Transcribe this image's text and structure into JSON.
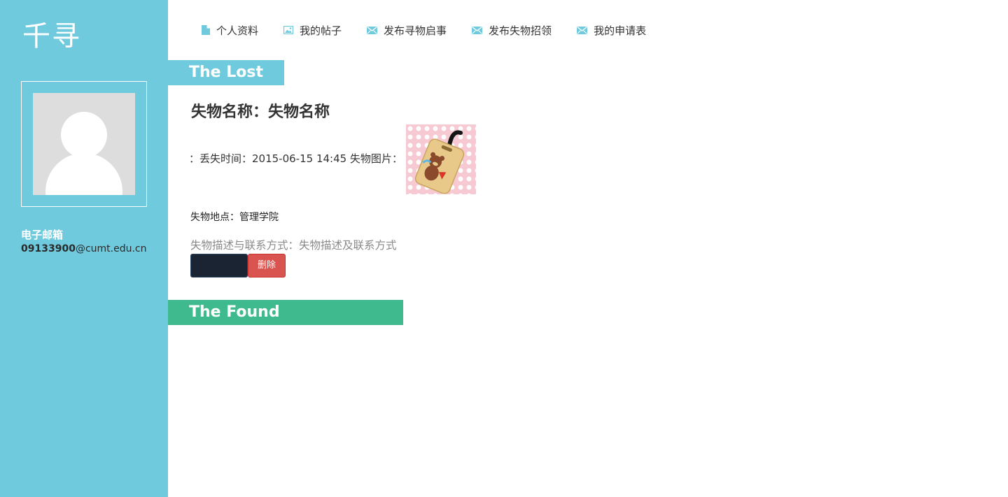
{
  "sidebar": {
    "site_title": "千寻",
    "email_label": "电子邮箱",
    "email_user": "09133900",
    "email_domain": "@cumt.edu.cn"
  },
  "nav": {
    "items": [
      {
        "label": "个人资料",
        "icon": "document-icon"
      },
      {
        "label": "我的帖子",
        "icon": "image-icon"
      },
      {
        "label": "发布寻物启事",
        "icon": "envelope-icon"
      },
      {
        "label": "发布失物招领",
        "icon": "envelope-icon"
      },
      {
        "label": "我的申请表",
        "icon": "envelope-icon"
      }
    ],
    "icon_color": "#6fcadd"
  },
  "lost_section": {
    "heading": "The Lost",
    "color": "#6fcadd",
    "item": {
      "title": "失物名称：失物名称",
      "time_row": "：丢失时间：2015-06-15 14:45 失物图片：",
      "location": "失物地点：管理学院",
      "description": "失物描述与联系方式：失物描述及联系方式",
      "delete_label": "删除"
    }
  },
  "found_section": {
    "heading": "The Found",
    "color": "#3fba8e"
  }
}
